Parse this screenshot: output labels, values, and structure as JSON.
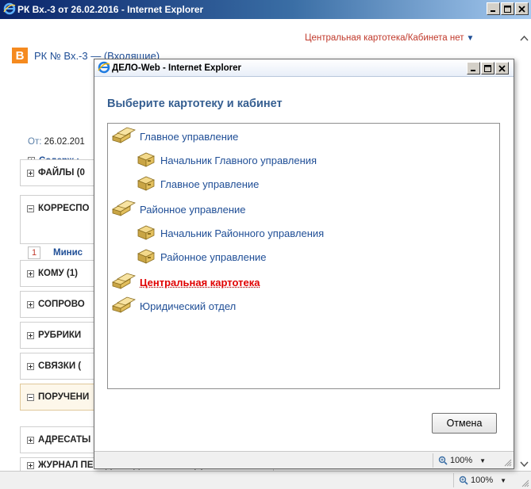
{
  "outer_window": {
    "title": "РК Вх.-3 от 26.02.2016 - Internet Explorer",
    "zoom": "100%"
  },
  "page": {
    "cabinet_link": "Центральная картотека/Кабинета нет",
    "badge": "B",
    "rk_title": "РК № Вх.-3 — (Входящие)",
    "from_label": "От:",
    "from_value": "26.02.201",
    "content_label": "Содерж.:",
    "sections": [
      {
        "label": "ФАЙЛЫ (0",
        "expanded": false,
        "highlight": false
      },
      {
        "label": "КОРРЕСПО",
        "expanded": true,
        "highlight": false
      },
      {
        "label": "КОМУ (1)",
        "expanded": false,
        "highlight": false
      },
      {
        "label": "СОПРОВО",
        "expanded": false,
        "highlight": false
      },
      {
        "label": "РУБРИКИ",
        "expanded": false,
        "highlight": false
      },
      {
        "label": "СВЯЗКИ (",
        "expanded": false,
        "highlight": false
      },
      {
        "label": "ПОРУЧЕНИ",
        "expanded": true,
        "highlight": true
      },
      {
        "label": "АДРЕСАТЫ",
        "expanded": false,
        "highlight": false
      },
      {
        "label": "ЖУРНАЛ ПЕРЕДАЧИ ДОКУМЕНТА (0)",
        "expanded": false,
        "highlight": false
      }
    ],
    "correspondent_item": {
      "number": "1",
      "name": "Минис"
    }
  },
  "dialog": {
    "title": "ДЕЛО-Web - Internet Explorer",
    "heading": "Выберите картотеку и кабинет",
    "tree": [
      {
        "label": "Главное управление",
        "level": 0,
        "icon": "cabinet-stack-icon",
        "active": false
      },
      {
        "label": "Начальник Главного управления",
        "level": 1,
        "icon": "cabinet-box-icon",
        "active": false
      },
      {
        "label": "Главное управление",
        "level": 1,
        "icon": "cabinet-box-icon",
        "active": false
      },
      {
        "label": "Районное управление",
        "level": 0,
        "icon": "cabinet-stack-icon",
        "active": false
      },
      {
        "label": "Начальник Районного управления",
        "level": 1,
        "icon": "cabinet-box-icon",
        "active": false
      },
      {
        "label": "Районное управление",
        "level": 1,
        "icon": "cabinet-box-icon",
        "active": false
      },
      {
        "label": "Центральная картотека",
        "level": 0,
        "icon": "cabinet-stack-icon",
        "active": true
      },
      {
        "label": "Юридический отдел",
        "level": 0,
        "icon": "cabinet-stack-icon",
        "active": false
      }
    ],
    "cancel_label": "Отмена",
    "zoom": "100%"
  },
  "colors": {
    "title_bar": "#0a246a",
    "link_blue": "#1f4e96",
    "active_red": "#e00000",
    "badge_orange": "#f58a1f",
    "heading_blue": "#365f91"
  }
}
